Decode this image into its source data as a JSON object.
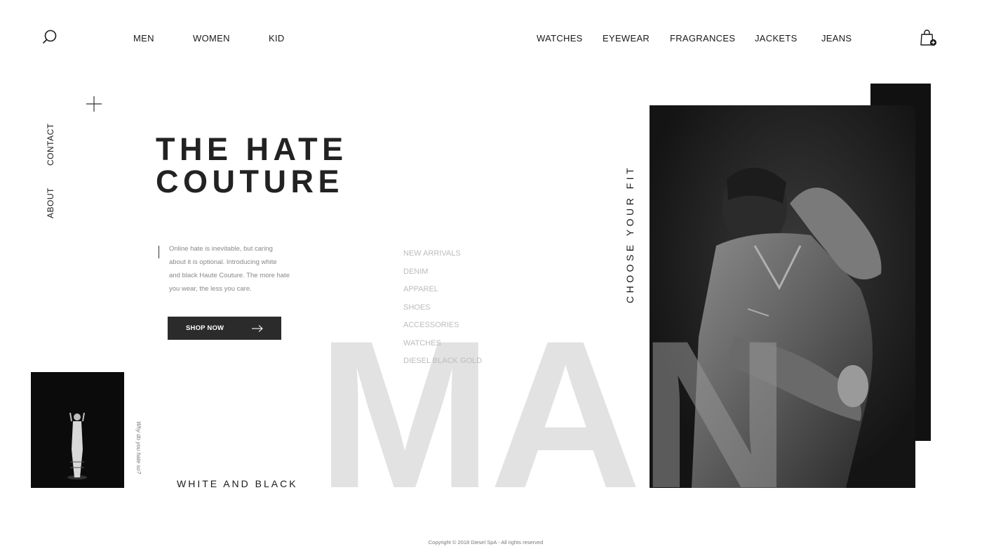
{
  "header": {
    "left_nav": [
      "MEN",
      "WOMEN",
      "KID"
    ],
    "right_nav": [
      "WATCHES",
      "EYEWEAR",
      "FRAGRANCES",
      "JACKETS",
      "JEANS"
    ],
    "icons": {
      "search": "search-icon",
      "cart": "shopping-bag-add-icon"
    }
  },
  "side_nav": {
    "items": [
      "CONTACT",
      "ABOUT"
    ],
    "icon": "plus-icon"
  },
  "hero": {
    "title_line1": "THE HATE",
    "title_line2": "COUTURE",
    "description": "Online hate is inevitable, but caring about it is optional. Introducing white and black Haute Couture. The more hate you wear, the less you care.",
    "cta_label": "SHOP NOW",
    "big_word": "MAN",
    "vertical_label": "CHOOSE YOUR FIT",
    "tagline": "WHITE AND BLACK",
    "small_caption": "Why do you hate so?"
  },
  "categories": [
    "NEW ARRIVALS",
    "DENIM",
    "APPAREL",
    "SHOES",
    "ACCESSORIES",
    "WATCHES",
    "DIESEL BLACK GOLD"
  ],
  "footer": {
    "copyright": "Copyright © 2018 Diesel SpA - All rights reserved"
  },
  "colors": {
    "text": "#1a1a1a",
    "muted": "#bcbcbc",
    "button": "#2b2b2b",
    "big_word": "#e2e2e2"
  }
}
